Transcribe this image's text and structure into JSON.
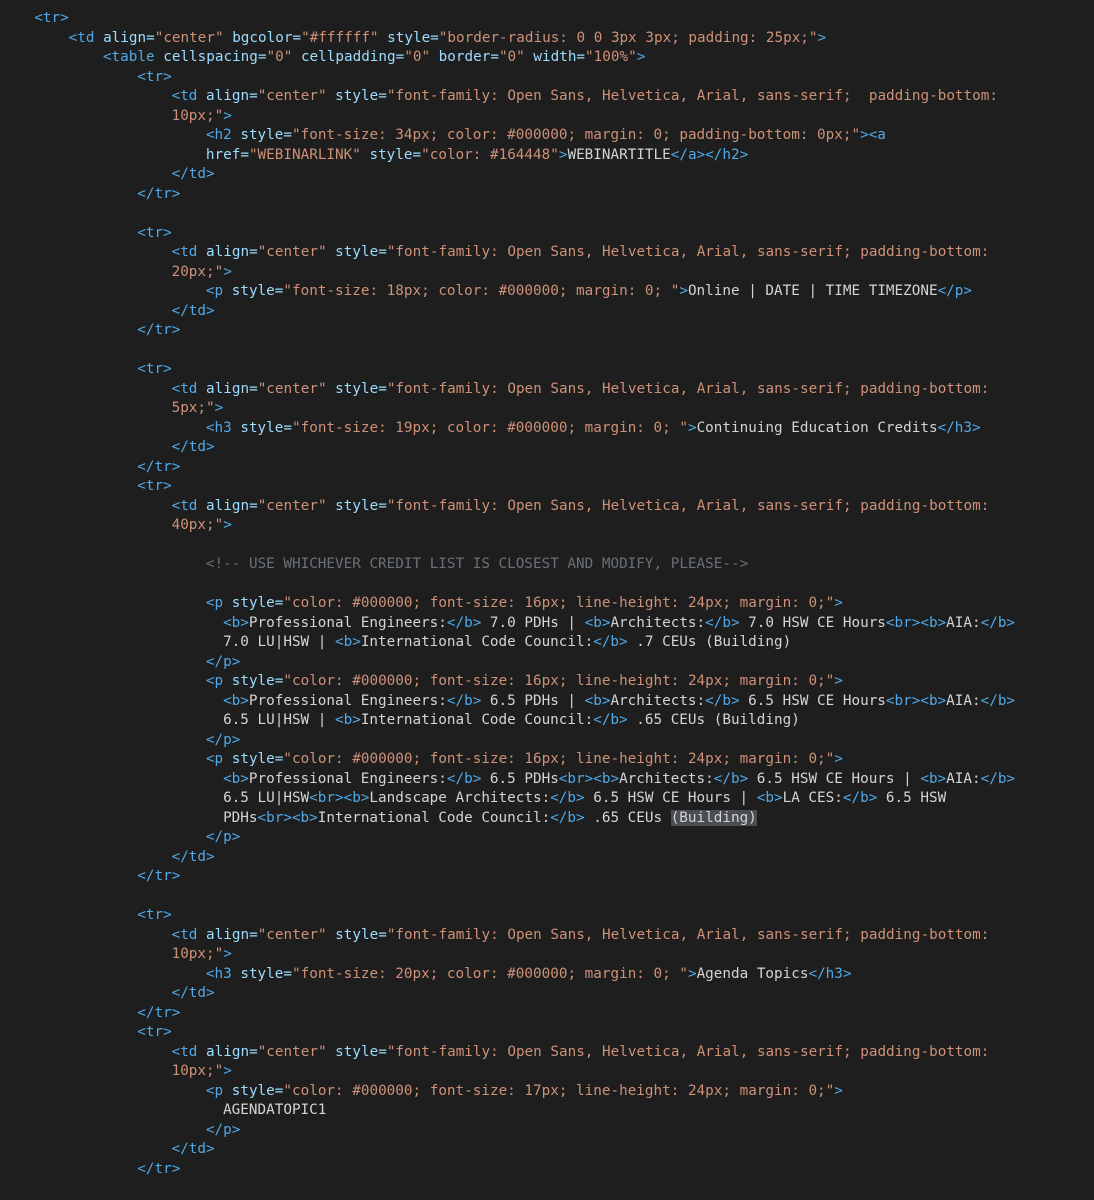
{
  "editor": {
    "lines": [
      {
        "indent": 4,
        "tokens": [
          {
            "k": "t",
            "s": "<tr>"
          }
        ]
      },
      {
        "indent": 8,
        "tokens": [
          {
            "k": "t",
            "s": "<td "
          },
          {
            "k": "a",
            "s": "align="
          },
          {
            "k": "v",
            "s": "\"center\""
          },
          {
            "k": "a",
            "s": " bgcolor="
          },
          {
            "k": "v",
            "s": "\"#ffffff\""
          },
          {
            "k": "a",
            "s": " style="
          },
          {
            "k": "v",
            "s": "\"border-radius: 0 0 3px 3px; padding: 25px;\""
          },
          {
            "k": "t",
            "s": ">"
          }
        ]
      },
      {
        "indent": 12,
        "tokens": [
          {
            "k": "t",
            "s": "<table "
          },
          {
            "k": "a",
            "s": "cellspacing="
          },
          {
            "k": "v",
            "s": "\"0\""
          },
          {
            "k": "a",
            "s": " cellpadding="
          },
          {
            "k": "v",
            "s": "\"0\""
          },
          {
            "k": "a",
            "s": " border="
          },
          {
            "k": "v",
            "s": "\"0\""
          },
          {
            "k": "a",
            "s": " width="
          },
          {
            "k": "v",
            "s": "\"100%\""
          },
          {
            "k": "t",
            "s": ">"
          }
        ]
      },
      {
        "indent": 16,
        "tokens": [
          {
            "k": "t",
            "s": "<tr>"
          }
        ]
      },
      {
        "indent": 20,
        "tokens": [
          {
            "k": "t",
            "s": "<td "
          },
          {
            "k": "a",
            "s": "align="
          },
          {
            "k": "v",
            "s": "\"center\""
          },
          {
            "k": "a",
            "s": " style="
          },
          {
            "k": "v",
            "s": "\"font-family: Open Sans, Helvetica, Arial, sans-serif;  padding-bottom:"
          }
        ]
      },
      {
        "indent": 20,
        "tokens": [
          {
            "k": "v",
            "s": "10px;\""
          },
          {
            "k": "t",
            "s": ">"
          }
        ]
      },
      {
        "indent": 24,
        "tokens": [
          {
            "k": "t",
            "s": "<h2 "
          },
          {
            "k": "a",
            "s": "style="
          },
          {
            "k": "v",
            "s": "\"font-size: 34px; color: #000000; margin: 0; padding-bottom: 0px;\""
          },
          {
            "k": "t",
            "s": "><a"
          }
        ]
      },
      {
        "indent": 24,
        "tokens": [
          {
            "k": "a",
            "s": "href="
          },
          {
            "k": "v",
            "s": "\"WEBINARLINK\""
          },
          {
            "k": "a",
            "s": " style="
          },
          {
            "k": "v",
            "s": "\"color: #164448\""
          },
          {
            "k": "t",
            "s": ">"
          },
          {
            "k": "tx",
            "s": "WEBINARTITLE"
          },
          {
            "k": "t",
            "s": "</a></h2>"
          }
        ]
      },
      {
        "indent": 20,
        "tokens": [
          {
            "k": "t",
            "s": "</td>"
          }
        ]
      },
      {
        "indent": 16,
        "tokens": [
          {
            "k": "t",
            "s": "</tr>"
          }
        ]
      },
      {
        "indent": 0,
        "tokens": []
      },
      {
        "indent": 16,
        "tokens": [
          {
            "k": "t",
            "s": "<tr>"
          }
        ]
      },
      {
        "indent": 20,
        "tokens": [
          {
            "k": "t",
            "s": "<td "
          },
          {
            "k": "a",
            "s": "align="
          },
          {
            "k": "v",
            "s": "\"center\""
          },
          {
            "k": "a",
            "s": " style="
          },
          {
            "k": "v",
            "s": "\"font-family: Open Sans, Helvetica, Arial, sans-serif; padding-bottom:"
          }
        ]
      },
      {
        "indent": 20,
        "tokens": [
          {
            "k": "v",
            "s": "20px;\""
          },
          {
            "k": "t",
            "s": ">"
          }
        ]
      },
      {
        "indent": 24,
        "tokens": [
          {
            "k": "t",
            "s": "<p "
          },
          {
            "k": "a",
            "s": "style="
          },
          {
            "k": "v",
            "s": "\"font-size: 18px; color: #000000; margin: 0; \""
          },
          {
            "k": "t",
            "s": ">"
          },
          {
            "k": "tx",
            "s": "Online | DATE | TIME TIMEZONE"
          },
          {
            "k": "t",
            "s": "</p>"
          }
        ]
      },
      {
        "indent": 20,
        "tokens": [
          {
            "k": "t",
            "s": "</td>"
          }
        ]
      },
      {
        "indent": 16,
        "tokens": [
          {
            "k": "t",
            "s": "</tr>"
          }
        ]
      },
      {
        "indent": 0,
        "tokens": []
      },
      {
        "indent": 16,
        "tokens": [
          {
            "k": "t",
            "s": "<tr>"
          }
        ]
      },
      {
        "indent": 20,
        "tokens": [
          {
            "k": "t",
            "s": "<td "
          },
          {
            "k": "a",
            "s": "align="
          },
          {
            "k": "v",
            "s": "\"center\""
          },
          {
            "k": "a",
            "s": " style="
          },
          {
            "k": "v",
            "s": "\"font-family: Open Sans, Helvetica, Arial, sans-serif; padding-bottom:"
          }
        ]
      },
      {
        "indent": 20,
        "tokens": [
          {
            "k": "v",
            "s": "5px;\""
          },
          {
            "k": "t",
            "s": ">"
          }
        ]
      },
      {
        "indent": 24,
        "tokens": [
          {
            "k": "t",
            "s": "<h3 "
          },
          {
            "k": "a",
            "s": "style="
          },
          {
            "k": "v",
            "s": "\"font-size: 19px; color: #000000; margin: 0; \""
          },
          {
            "k": "t",
            "s": ">"
          },
          {
            "k": "tx",
            "s": "Continuing Education Credits"
          },
          {
            "k": "t",
            "s": "</h3>"
          }
        ]
      },
      {
        "indent": 20,
        "tokens": [
          {
            "k": "t",
            "s": "</td>"
          }
        ]
      },
      {
        "indent": 16,
        "tokens": [
          {
            "k": "t",
            "s": "</tr>"
          }
        ]
      },
      {
        "indent": 16,
        "tokens": [
          {
            "k": "t",
            "s": "<tr>"
          }
        ]
      },
      {
        "indent": 20,
        "tokens": [
          {
            "k": "t",
            "s": "<td "
          },
          {
            "k": "a",
            "s": "align="
          },
          {
            "k": "v",
            "s": "\"center\""
          },
          {
            "k": "a",
            "s": " style="
          },
          {
            "k": "v",
            "s": "\"font-family: Open Sans, Helvetica, Arial, sans-serif; padding-bottom:"
          }
        ]
      },
      {
        "indent": 20,
        "tokens": [
          {
            "k": "v",
            "s": "40px;\""
          },
          {
            "k": "t",
            "s": ">"
          }
        ]
      },
      {
        "indent": 0,
        "tokens": []
      },
      {
        "indent": 24,
        "tokens": [
          {
            "k": "c",
            "s": "<!-- USE WHICHEVER CREDIT LIST IS CLOSEST AND MODIFY, PLEASE-->"
          }
        ]
      },
      {
        "indent": 0,
        "tokens": []
      },
      {
        "indent": 24,
        "tokens": [
          {
            "k": "t",
            "s": "<p "
          },
          {
            "k": "a",
            "s": "style="
          },
          {
            "k": "v",
            "s": "\"color: #000000; font-size: 16px; line-height: 24px; margin: 0;\""
          },
          {
            "k": "t",
            "s": ">"
          }
        ]
      },
      {
        "indent": 26,
        "tokens": [
          {
            "k": "t",
            "s": "<b>"
          },
          {
            "k": "tx",
            "s": "Professional Engineers:"
          },
          {
            "k": "t",
            "s": "</b>"
          },
          {
            "k": "tx",
            "s": " 7.0 PDHs | "
          },
          {
            "k": "t",
            "s": "<b>"
          },
          {
            "k": "tx",
            "s": "Architects:"
          },
          {
            "k": "t",
            "s": "</b>"
          },
          {
            "k": "tx",
            "s": " 7.0 HSW CE Hours"
          },
          {
            "k": "t",
            "s": "<br><b>"
          },
          {
            "k": "tx",
            "s": "AIA:"
          },
          {
            "k": "t",
            "s": "</b>"
          }
        ]
      },
      {
        "indent": 26,
        "tokens": [
          {
            "k": "tx",
            "s": "7.0 LU|HSW | "
          },
          {
            "k": "t",
            "s": "<b>"
          },
          {
            "k": "tx",
            "s": "International Code Council:"
          },
          {
            "k": "t",
            "s": "</b>"
          },
          {
            "k": "tx",
            "s": " .7 CEUs (Building)"
          }
        ]
      },
      {
        "indent": 24,
        "tokens": [
          {
            "k": "t",
            "s": "</p>"
          }
        ]
      },
      {
        "indent": 24,
        "tokens": [
          {
            "k": "t",
            "s": "<p "
          },
          {
            "k": "a",
            "s": "style="
          },
          {
            "k": "v",
            "s": "\"color: #000000; font-size: 16px; line-height: 24px; margin: 0;\""
          },
          {
            "k": "t",
            "s": ">"
          }
        ]
      },
      {
        "indent": 26,
        "tokens": [
          {
            "k": "t",
            "s": "<b>"
          },
          {
            "k": "tx",
            "s": "Professional Engineers:"
          },
          {
            "k": "t",
            "s": "</b>"
          },
          {
            "k": "tx",
            "s": " 6.5 PDHs | "
          },
          {
            "k": "t",
            "s": "<b>"
          },
          {
            "k": "tx",
            "s": "Architects:"
          },
          {
            "k": "t",
            "s": "</b>"
          },
          {
            "k": "tx",
            "s": " 6.5 HSW CE Hours"
          },
          {
            "k": "t",
            "s": "<br><b>"
          },
          {
            "k": "tx",
            "s": "AIA:"
          },
          {
            "k": "t",
            "s": "</b>"
          }
        ]
      },
      {
        "indent": 26,
        "tokens": [
          {
            "k": "tx",
            "s": "6.5 LU|HSW | "
          },
          {
            "k": "t",
            "s": "<b>"
          },
          {
            "k": "tx",
            "s": "International Code Council:"
          },
          {
            "k": "t",
            "s": "</b>"
          },
          {
            "k": "tx",
            "s": " .65 CEUs (Building)"
          }
        ]
      },
      {
        "indent": 24,
        "tokens": [
          {
            "k": "t",
            "s": "</p>"
          }
        ]
      },
      {
        "indent": 24,
        "tokens": [
          {
            "k": "t",
            "s": "<p "
          },
          {
            "k": "a",
            "s": "style="
          },
          {
            "k": "v",
            "s": "\"color: #000000; font-size: 16px; line-height: 24px; margin: 0;\""
          },
          {
            "k": "t",
            "s": ">"
          }
        ]
      },
      {
        "indent": 26,
        "tokens": [
          {
            "k": "t",
            "s": "<b>"
          },
          {
            "k": "tx",
            "s": "Professional Engineers:"
          },
          {
            "k": "t",
            "s": "</b>"
          },
          {
            "k": "tx",
            "s": " 6.5 PDHs"
          },
          {
            "k": "t",
            "s": "<br><b>"
          },
          {
            "k": "tx",
            "s": "Architects:"
          },
          {
            "k": "t",
            "s": "</b>"
          },
          {
            "k": "tx",
            "s": " 6.5 HSW CE Hours | "
          },
          {
            "k": "t",
            "s": "<b>"
          },
          {
            "k": "tx",
            "s": "AIA:"
          },
          {
            "k": "t",
            "s": "</b>"
          }
        ]
      },
      {
        "indent": 26,
        "tokens": [
          {
            "k": "tx",
            "s": "6.5 LU|HSW"
          },
          {
            "k": "t",
            "s": "<br><b>"
          },
          {
            "k": "tx",
            "s": "Landscape Architects:"
          },
          {
            "k": "t",
            "s": "</b>"
          },
          {
            "k": "tx",
            "s": " 6.5 HSW CE Hours | "
          },
          {
            "k": "t",
            "s": "<b>"
          },
          {
            "k": "tx",
            "s": "LA CES:"
          },
          {
            "k": "t",
            "s": "</b>"
          },
          {
            "k": "tx",
            "s": " 6.5 HSW"
          }
        ]
      },
      {
        "indent": 26,
        "tokens": [
          {
            "k": "tx",
            "s": "PDHs"
          },
          {
            "k": "t",
            "s": "<br><b>"
          },
          {
            "k": "tx",
            "s": "International Code Council:"
          },
          {
            "k": "t",
            "s": "</b>"
          },
          {
            "k": "tx",
            "s": " .65 CEUs "
          },
          {
            "k": "hl",
            "s": "(Building)"
          }
        ]
      },
      {
        "indent": 24,
        "tokens": [
          {
            "k": "t",
            "s": "</p>"
          }
        ]
      },
      {
        "indent": 20,
        "tokens": [
          {
            "k": "t",
            "s": "</td>"
          }
        ]
      },
      {
        "indent": 16,
        "tokens": [
          {
            "k": "t",
            "s": "</tr>"
          }
        ]
      },
      {
        "indent": 0,
        "tokens": []
      },
      {
        "indent": 16,
        "tokens": [
          {
            "k": "t",
            "s": "<tr>"
          }
        ]
      },
      {
        "indent": 20,
        "tokens": [
          {
            "k": "t",
            "s": "<td "
          },
          {
            "k": "a",
            "s": "align="
          },
          {
            "k": "v",
            "s": "\"center\""
          },
          {
            "k": "a",
            "s": " style="
          },
          {
            "k": "v",
            "s": "\"font-family: Open Sans, Helvetica, Arial, sans-serif; padding-bottom:"
          }
        ]
      },
      {
        "indent": 20,
        "tokens": [
          {
            "k": "v",
            "s": "10px;\""
          },
          {
            "k": "t",
            "s": ">"
          }
        ]
      },
      {
        "indent": 24,
        "tokens": [
          {
            "k": "t",
            "s": "<h3 "
          },
          {
            "k": "a",
            "s": "style="
          },
          {
            "k": "v",
            "s": "\"font-size: 20px; color: #000000; margin: 0; \""
          },
          {
            "k": "t",
            "s": ">"
          },
          {
            "k": "tx",
            "s": "Agenda Topics"
          },
          {
            "k": "t",
            "s": "</h3>"
          }
        ]
      },
      {
        "indent": 20,
        "tokens": [
          {
            "k": "t",
            "s": "</td>"
          }
        ]
      },
      {
        "indent": 16,
        "tokens": [
          {
            "k": "t",
            "s": "</tr>"
          }
        ]
      },
      {
        "indent": 16,
        "tokens": [
          {
            "k": "t",
            "s": "<tr>"
          }
        ]
      },
      {
        "indent": 20,
        "tokens": [
          {
            "k": "t",
            "s": "<td "
          },
          {
            "k": "a",
            "s": "align="
          },
          {
            "k": "v",
            "s": "\"center\""
          },
          {
            "k": "a",
            "s": " style="
          },
          {
            "k": "v",
            "s": "\"font-family: Open Sans, Helvetica, Arial, sans-serif; padding-bottom:"
          }
        ]
      },
      {
        "indent": 20,
        "tokens": [
          {
            "k": "v",
            "s": "10px;\""
          },
          {
            "k": "t",
            "s": ">"
          }
        ]
      },
      {
        "indent": 24,
        "tokens": [
          {
            "k": "t",
            "s": "<p "
          },
          {
            "k": "a",
            "s": "style="
          },
          {
            "k": "v",
            "s": "\"color: #000000; font-size: 17px; line-height: 24px; margin: 0;\""
          },
          {
            "k": "t",
            "s": ">"
          }
        ]
      },
      {
        "indent": 26,
        "tokens": [
          {
            "k": "tx",
            "s": "AGENDATOPIC1"
          }
        ]
      },
      {
        "indent": 24,
        "tokens": [
          {
            "k": "t",
            "s": "</p>"
          }
        ]
      },
      {
        "indent": 20,
        "tokens": [
          {
            "k": "t",
            "s": "</td>"
          }
        ]
      },
      {
        "indent": 16,
        "tokens": [
          {
            "k": "t",
            "s": "</tr>"
          }
        ]
      }
    ]
  },
  "colors": {
    "background": "#1e1e1e",
    "tag": "#4fa9e8",
    "attribute": "#9cdcfe",
    "value": "#ce9178",
    "text": "#d4d4d4",
    "comment": "#6a7079",
    "selection_highlight": "#4a4d52"
  }
}
